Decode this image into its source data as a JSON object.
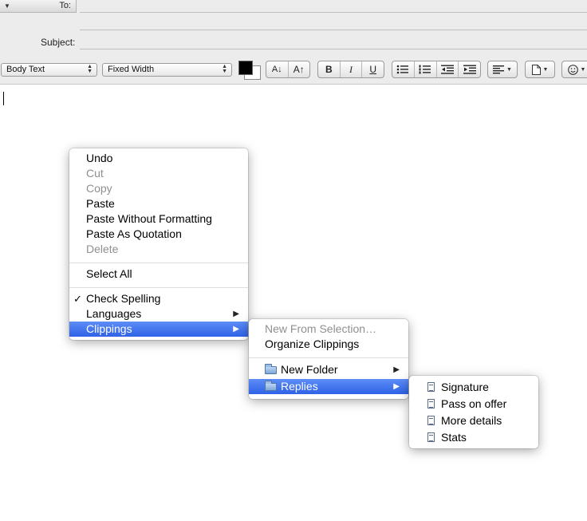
{
  "header": {
    "to_label": "To:",
    "subject_label": "Subject:"
  },
  "toolbar": {
    "style_select": "Body Text",
    "font_select": "Fixed Width",
    "text_color": "#000000",
    "font_decrease": "A↓",
    "font_increase": "A↑",
    "bold": "B",
    "italic": "I",
    "underline": "U"
  },
  "context_menu": {
    "items": [
      {
        "label": "Undo",
        "enabled": true
      },
      {
        "label": "Cut",
        "enabled": false
      },
      {
        "label": "Copy",
        "enabled": false
      },
      {
        "label": "Paste",
        "enabled": true
      },
      {
        "label": "Paste Without Formatting",
        "enabled": true
      },
      {
        "label": "Paste As Quotation",
        "enabled": true
      },
      {
        "label": "Delete",
        "enabled": false
      },
      {
        "label": "Select All",
        "enabled": true
      },
      {
        "label": "Check Spelling",
        "enabled": true,
        "checked": true
      },
      {
        "label": "Languages",
        "enabled": true,
        "submenu": true
      },
      {
        "label": "Clippings",
        "enabled": true,
        "submenu": true,
        "highlighted": true
      }
    ]
  },
  "clippings_menu": {
    "items": [
      {
        "label": "New From Selection…",
        "enabled": false
      },
      {
        "label": "Organize Clippings",
        "enabled": true
      },
      {
        "label": "New Folder",
        "enabled": true,
        "submenu": true,
        "icon": "folder-icon"
      },
      {
        "label": "Replies",
        "enabled": true,
        "submenu": true,
        "highlighted": true,
        "icon": "folder-icon"
      }
    ]
  },
  "replies_menu": {
    "items": [
      {
        "label": "Signature",
        "icon": "document-icon"
      },
      {
        "label": "Pass on offer",
        "icon": "document-icon"
      },
      {
        "label": "More details",
        "icon": "document-icon"
      },
      {
        "label": "Stats",
        "icon": "document-icon"
      }
    ]
  },
  "colors": {
    "highlight": "#3a6eea",
    "disabled_text": "#8f8f8f"
  }
}
